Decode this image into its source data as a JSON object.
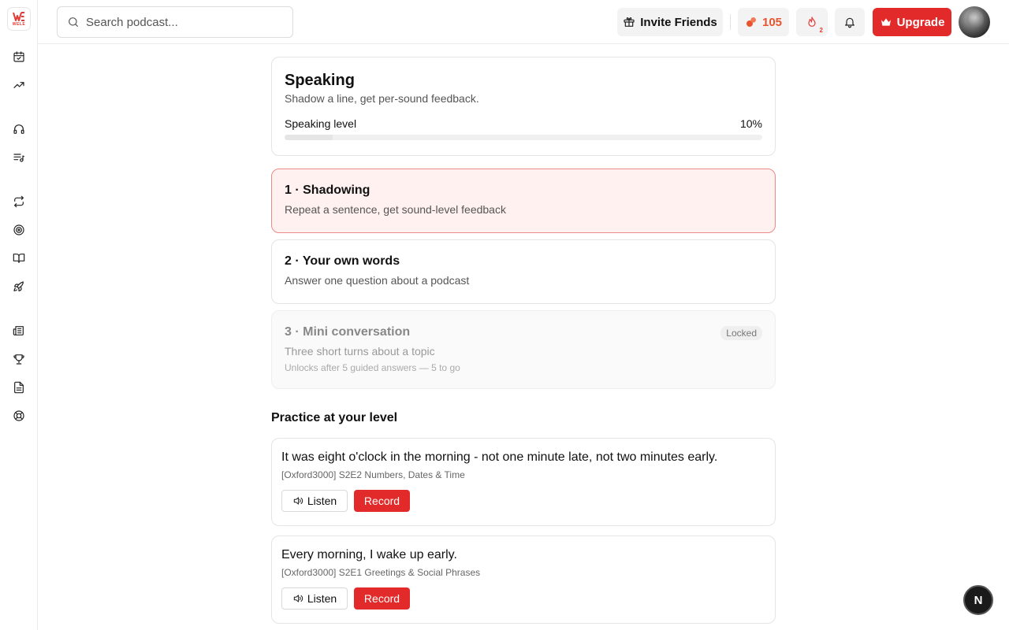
{
  "brand": {
    "logo_text": "WELE",
    "accent": "#e32a2a"
  },
  "sidebar": {
    "items": [
      {
        "name": "calendar-check-icon"
      },
      {
        "name": "trending-up-icon"
      },
      {
        "name": "headphones-icon"
      },
      {
        "name": "playlist-icon"
      },
      {
        "name": "repeat-icon"
      },
      {
        "name": "target-icon"
      },
      {
        "name": "book-open-icon"
      },
      {
        "name": "rocket-icon"
      },
      {
        "name": "newspaper-icon"
      },
      {
        "name": "trophy-icon"
      },
      {
        "name": "file-text-icon"
      },
      {
        "name": "lifebuoy-icon"
      }
    ]
  },
  "header": {
    "search_placeholder": "Search podcast...",
    "invite_label": "Invite Friends",
    "coins": "105",
    "streak_count": "2",
    "upgrade_label": "Upgrade"
  },
  "speaking": {
    "title": "Speaking",
    "subtitle": "Shadow a line, get per-sound feedback.",
    "level_label": "Speaking level",
    "level_value": "10%",
    "level_fraction": 0.1
  },
  "steps": [
    {
      "title": "1 · Shadowing",
      "subtitle": "Repeat a sentence, get sound-level feedback"
    },
    {
      "title": "2 · Your own words",
      "subtitle": "Answer one question about a podcast"
    },
    {
      "title": "3 · Mini conversation",
      "subtitle": "Three short turns about a topic",
      "badge": "Locked",
      "note": "Unlocks after 5 guided answers — 5 to go"
    }
  ],
  "practice": {
    "title": "Practice at your level",
    "listen_label": "Listen",
    "record_label": "Record",
    "items": [
      {
        "text": "It was eight o'clock in the morning - not one minute late, not two minutes early.",
        "meta": "[Oxford3000] S2E2 Numbers, Dates & Time"
      },
      {
        "text": "Every morning, I wake up early.",
        "meta": "[Oxford3000] S2E1 Greetings & Social Phrases"
      }
    ]
  },
  "fab_label": "N"
}
